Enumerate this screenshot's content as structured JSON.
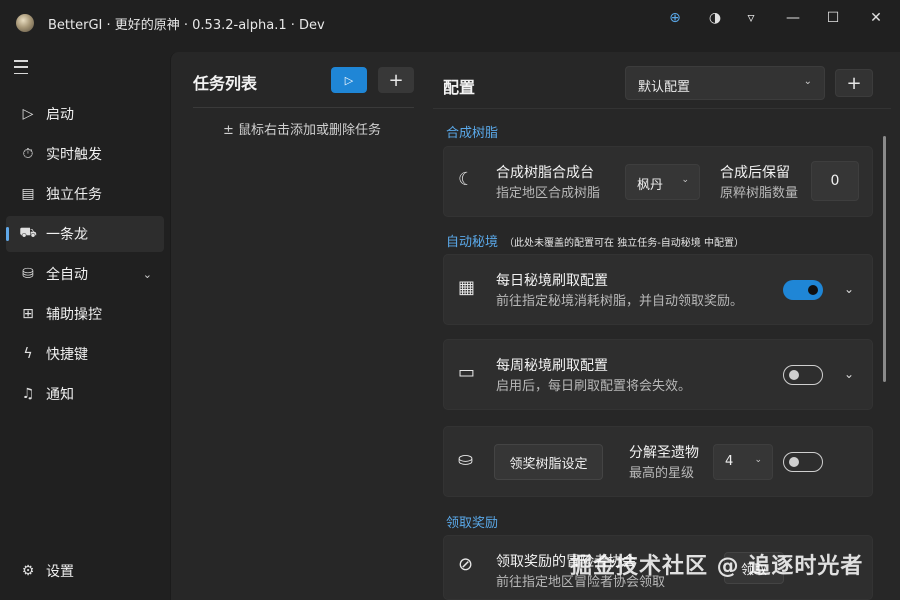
{
  "window": {
    "title": "BetterGI · 更好的原神 · 0.53.2-alpha.1 · Dev",
    "controls": {
      "globe": "⊕",
      "theme": "◑",
      "menu": "▿",
      "minimize": "—",
      "maximize": "☐",
      "close": "✕"
    }
  },
  "sidebar": {
    "items": [
      {
        "icon": "play-icon",
        "glyph": "▷",
        "label": "启动"
      },
      {
        "icon": "timer-icon",
        "glyph": "⏱",
        "label": "实时触发"
      },
      {
        "icon": "task-icon",
        "glyph": "▤",
        "label": "独立任务"
      },
      {
        "icon": "dragon-icon",
        "glyph": "⛟",
        "label": "一条龙",
        "active": true
      },
      {
        "icon": "auto-icon",
        "glyph": "⛁",
        "label": "全自动",
        "chevron": "⌄"
      },
      {
        "icon": "gamepad-icon",
        "glyph": "⊞",
        "label": "辅助操控"
      },
      {
        "icon": "lightning-icon",
        "glyph": "ϟ",
        "label": "快捷键"
      },
      {
        "icon": "bell-icon",
        "glyph": "♫",
        "label": "通知"
      }
    ],
    "settings": {
      "glyph": "⚙",
      "label": "设置"
    }
  },
  "tasks": {
    "title": "任务列表",
    "run_glyph": "▷",
    "add_glyph": "+",
    "hint": "± 鼠标右击添加或删除任务"
  },
  "config": {
    "title": "配置",
    "selected": "默认配置",
    "add_glyph": "+",
    "sections": {
      "resin": {
        "header": "合成树脂",
        "card": {
          "icon_glyph": "☾",
          "title": "合成树脂合成台",
          "subtitle": "指定地区合成树脂",
          "region": "枫丹",
          "keep_title": "合成后保留",
          "keep_subtitle": "原粹树脂数量",
          "keep_value": "0"
        }
      },
      "domain": {
        "header": "自动秘境",
        "note": "（此处未覆盖的配置可在 独立任务-自动秘境 中配置）",
        "daily": {
          "icon_glyph": "▦",
          "title": "每日秘境刷取配置",
          "subtitle": "前往指定秘境消耗树脂，并自动领取奖励。",
          "enabled": true
        },
        "weekly": {
          "icon_glyph": "▭",
          "title": "每周秘境刷取配置",
          "subtitle": "启用后，每日刷取配置将会失效。",
          "enabled": false
        },
        "artifact": {
          "icon_glyph": "⛀",
          "button": "领奖树脂设定",
          "title": "分解圣遗物",
          "subtitle": "最高的星级",
          "stars": "4",
          "enabled": false
        }
      },
      "reward": {
        "header": "领取奖励",
        "card": {
          "icon_glyph": "⊘",
          "title": "领取奖励的冒险者协会",
          "subtitle": "前往指定地区冒险者协会领取",
          "button": "领取"
        }
      }
    }
  },
  "watermark": "掘金技术社区 @ 追逐时光者",
  "colors": {
    "accent": "#1f86d6",
    "section": "#5aa8e8"
  }
}
